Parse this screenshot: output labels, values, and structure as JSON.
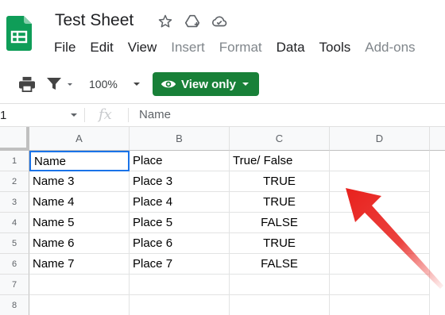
{
  "doc": {
    "title": "Test Sheet"
  },
  "menu": [
    "File",
    "Edit",
    "View",
    "Insert",
    "Format",
    "Data",
    "Tools",
    "Add-ons"
  ],
  "toolbar": {
    "zoom": "100%",
    "view_only_label": "View only"
  },
  "formula_bar": {
    "cell_ref": "1",
    "fx": "fx",
    "content": "Name"
  },
  "columns": [
    "A",
    "B",
    "C",
    "D"
  ],
  "rows": [
    "1",
    "2",
    "3",
    "4",
    "5",
    "6",
    "7",
    "8"
  ],
  "cells": [
    [
      "Name",
      "Place",
      "True/ False"
    ],
    [
      "Name 3",
      "Place 3",
      "TRUE"
    ],
    [
      "Name 4",
      "Place 4",
      "TRUE"
    ],
    [
      "Name 5",
      "Place 5",
      "FALSE"
    ],
    [
      "Name 6",
      "Place 6",
      "TRUE"
    ],
    [
      "Name 7",
      "Place 7",
      "FALSE"
    ]
  ],
  "colors": {
    "brand_green": "#188038",
    "logo_green": "#0f9d58",
    "selection_blue": "#1a73e8",
    "arrow_red": "#e8211d"
  }
}
